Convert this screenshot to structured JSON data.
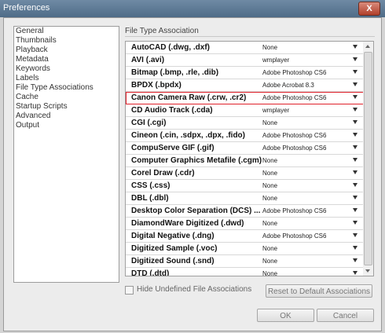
{
  "window": {
    "title": "Preferences",
    "close_label": "X"
  },
  "nav": {
    "items": [
      "General",
      "Thumbnails",
      "Playback",
      "Metadata",
      "Keywords",
      "Labels",
      "File Type Associations",
      "Cache",
      "Startup Scripts",
      "Advanced",
      "Output"
    ]
  },
  "section": {
    "title": "File Type Association"
  },
  "associations": [
    {
      "name": "AutoCAD (.dwg, .dxf)",
      "app": "None",
      "highlighted": false
    },
    {
      "name": "AVI (.avi)",
      "app": "wmplayer",
      "highlighted": false
    },
    {
      "name": "Bitmap (.bmp, .rle, .dib)",
      "app": "Adobe Photoshop CS6",
      "highlighted": false
    },
    {
      "name": "BPDX (.bpdx)",
      "app": "Adobe Acrobat 8.3",
      "highlighted": false
    },
    {
      "name": "Canon Camera Raw (.crw, .cr2)",
      "app": "Adobe Photoshop CS6",
      "highlighted": true
    },
    {
      "name": "CD Audio Track (.cda)",
      "app": "wmplayer",
      "highlighted": false
    },
    {
      "name": "CGI (.cgi)",
      "app": "None",
      "highlighted": false
    },
    {
      "name": "Cineon (.cin, .sdpx, .dpx, .fido)",
      "app": "Adobe Photoshop CS6",
      "highlighted": false
    },
    {
      "name": "CompuServe GIF (.gif)",
      "app": "Adobe Photoshop CS6",
      "highlighted": false
    },
    {
      "name": "Computer Graphics Metafile (.cgm)",
      "app": "None",
      "highlighted": false
    },
    {
      "name": "Corel Draw (.cdr)",
      "app": "None",
      "highlighted": false
    },
    {
      "name": "CSS (.css)",
      "app": "None",
      "highlighted": false
    },
    {
      "name": "DBL (.dbl)",
      "app": "None",
      "highlighted": false
    },
    {
      "name": "Desktop Color Separation (DCS) ...",
      "app": "Adobe Photoshop CS6",
      "highlighted": false
    },
    {
      "name": "DiamondWare Digitized (.dwd)",
      "app": "None",
      "highlighted": false
    },
    {
      "name": "Digital Negative (.dng)",
      "app": "Adobe Photoshop CS6",
      "highlighted": false
    },
    {
      "name": "Digitized Sample (.voc)",
      "app": "None",
      "highlighted": false
    },
    {
      "name": "Digitized Sound (.snd)",
      "app": "None",
      "highlighted": false
    },
    {
      "name": "DTD (.dtd)",
      "app": "None",
      "highlighted": false
    }
  ],
  "options": {
    "hide_undefined_label": "Hide Undefined File Associations",
    "hide_undefined_checked": false
  },
  "buttons": {
    "reset": "Reset to Default Associations",
    "ok": "OK",
    "cancel": "Cancel"
  },
  "colors": {
    "highlight_border": "#e0202a"
  }
}
